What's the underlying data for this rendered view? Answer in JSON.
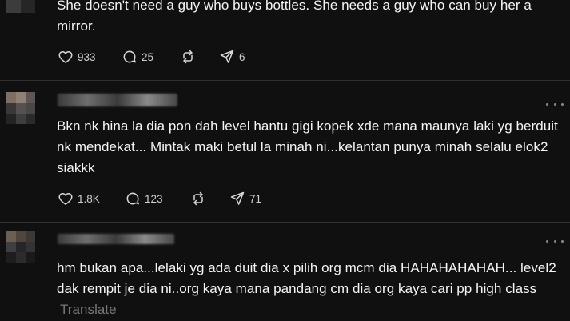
{
  "posts": [
    {
      "text": "She doesn't need a guy who buys bottles. She needs a guy who can buy her a mirror.",
      "likes": "933",
      "replies": "25",
      "shares": "6"
    },
    {
      "text": "Bkn nk hina la dia pon dah level hantu gigi kopek xde mana maunya laki yg berduit nk mendekat... Mintak maki betul la minah ni...kelantan punya minah selalu elok2 siakkk",
      "likes": "1.8K",
      "replies": "123",
      "shares": "71"
    },
    {
      "text": "hm bukan apa...lelaki yg ada duit dia x pilih org mcm dia HAHAHAHAHAH... level2 dak rempit je dia ni..org kaya mana pandang cm dia org kaya cari pp high class",
      "translate": "Translate"
    }
  ],
  "icons": {
    "like": "heart-icon",
    "reply": "comment-icon",
    "repost": "repost-icon",
    "share": "send-icon",
    "more": "more-icon"
  },
  "colors": {
    "background": "#101010",
    "text": "#f3f5f7",
    "muted": "#777777",
    "divider": "#2f2f2f"
  }
}
